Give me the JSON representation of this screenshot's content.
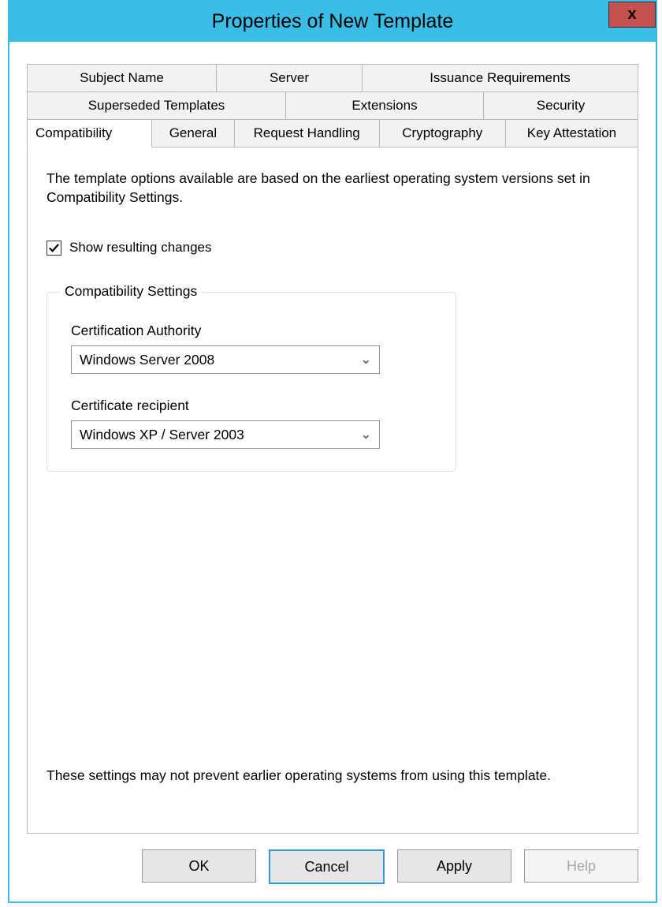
{
  "title": "Properties of New Template",
  "close_glyph": "x",
  "tabs": {
    "row1": [
      "Subject Name",
      "Server",
      "Issuance Requirements"
    ],
    "row2": [
      "Superseded Templates",
      "Extensions",
      "Security"
    ],
    "row3": [
      "Compatibility",
      "General",
      "Request Handling",
      "Cryptography",
      "Key Attestation"
    ],
    "active": "Compatibility"
  },
  "compat": {
    "intro": "The template options available are based on the earliest operating system versions set in Compatibility Settings.",
    "show_resulting_label": "Show resulting changes",
    "show_resulting_checked": true,
    "groupbox_label": "Compatibility Settings",
    "ca_label": "Certification Authority",
    "ca_value": "Windows Server 2008",
    "recipient_label": "Certificate recipient",
    "recipient_value": "Windows XP / Server 2003",
    "disclaimer": "These settings may not prevent earlier operating systems from using this template."
  },
  "buttons": {
    "ok": "OK",
    "cancel": "Cancel",
    "apply": "Apply",
    "help": "Help"
  }
}
